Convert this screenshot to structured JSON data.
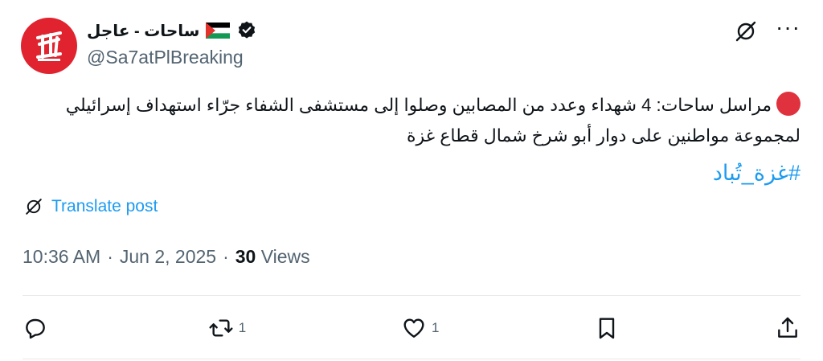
{
  "account": {
    "display_name": "ساحات - عاجل",
    "handle": "@Sa7atPlBreaking",
    "avatar_icon": "sa7at-logo-icon",
    "flag_icon": "palestine-flag-icon",
    "verified_icon": "verified-badge-icon"
  },
  "tweet": {
    "line1": "مراسل ساحات: 4 شهداء وعدد من المصابين وصلوا إلى مستشفى الشفاء جرّاء استهداف إسرائيلي",
    "line2": "لمجموعة مواطنين على دوار أبو شرخ شمال قطاع غزة",
    "hashtag": "#غزة_تُباد"
  },
  "translate_label": "Translate post",
  "meta": {
    "time": "10:36 AM",
    "date": "Jun 2, 2025",
    "views_count": "30",
    "views_label": "Views"
  },
  "actions": {
    "reply_count": "",
    "repost_count": "1",
    "like_count": "1"
  },
  "colors": {
    "accent": "#1d9bf0",
    "brand_red": "#e0232f",
    "secondary_text": "#536471"
  }
}
